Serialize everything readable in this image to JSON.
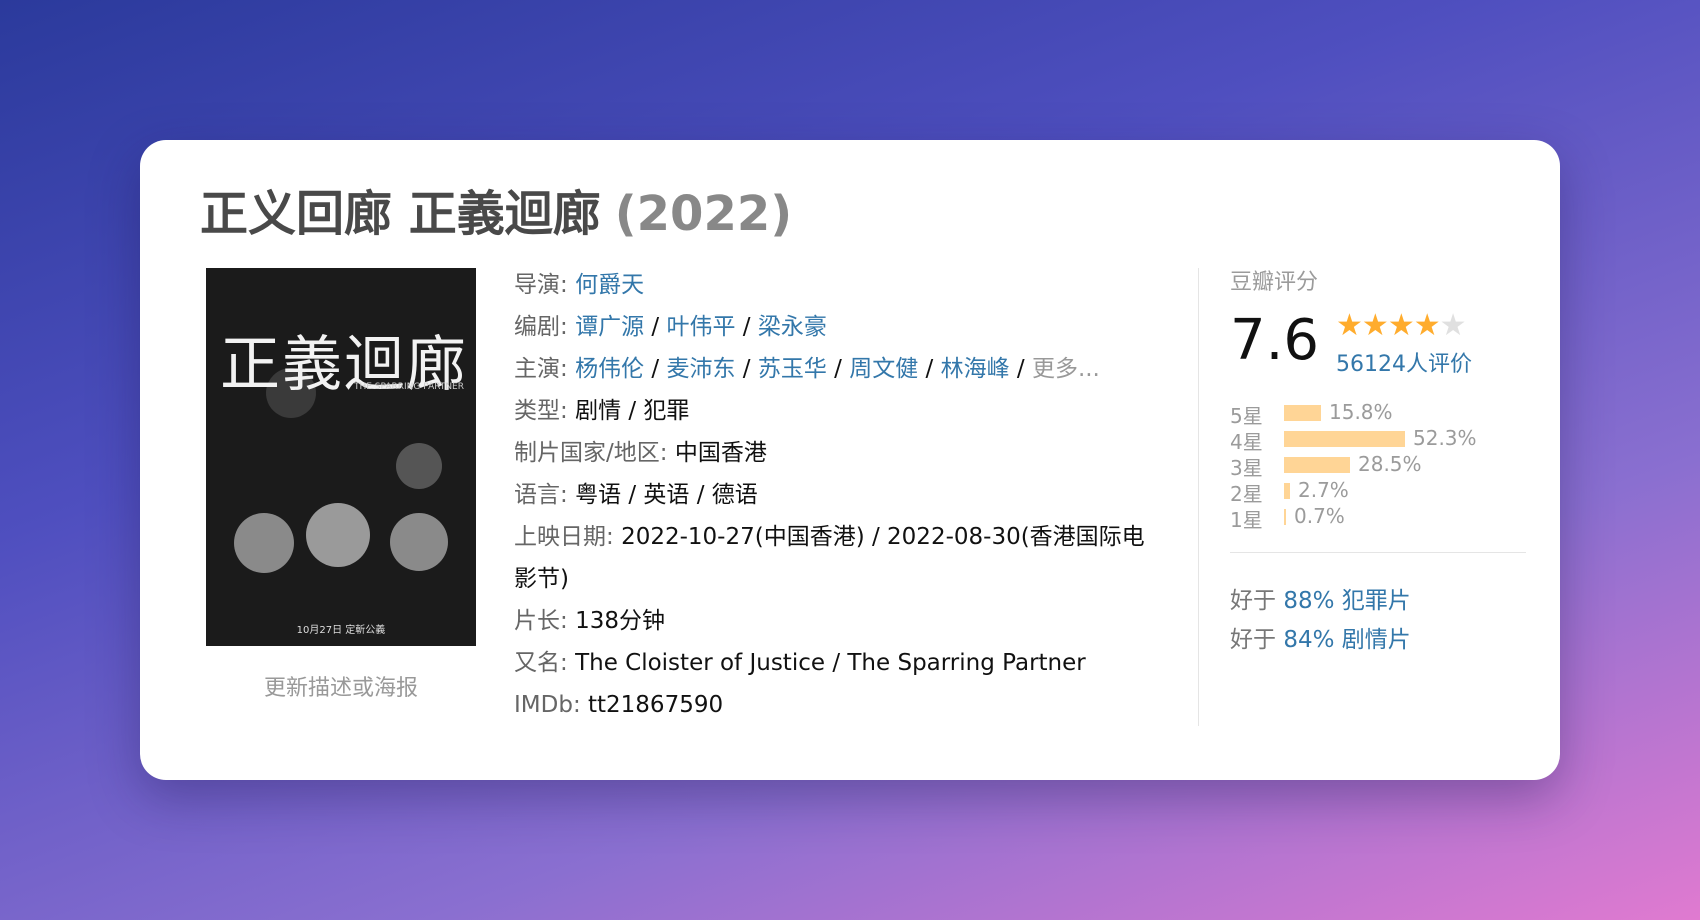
{
  "movie": {
    "title": "正义回廊 正義迴廊",
    "year": "(2022)"
  },
  "poster": {
    "title_art": "正義迴廊",
    "subtitle": "THE SPARRING PARTNER",
    "release_note": "10月27日 定斬公義",
    "update_link": "更新描述或海报"
  },
  "info": {
    "director_label": "导演:",
    "director": "何爵天",
    "writer_label": "编剧:",
    "writers": [
      "谭广源",
      "叶伟平",
      "梁永豪"
    ],
    "cast_label": "主演:",
    "cast": [
      "杨伟伦",
      "麦沛东",
      "苏玉华",
      "周文健",
      "林海峰"
    ],
    "more": "更多...",
    "genre_label": "类型:",
    "genres": "剧情 / 犯罪",
    "country_label": "制片国家/地区:",
    "country": "中国香港",
    "language_label": "语言:",
    "languages": "粤语 / 英语 / 德语",
    "release_label": "上映日期:",
    "release": "2022-10-27(中国香港) / 2022-08-30(香港国际电影节)",
    "runtime_label": "片长:",
    "runtime": "138分钟",
    "aka_label": "又名:",
    "aka": "The Cloister of Justice / The Sparring Partner",
    "imdb_label": "IMDb:",
    "imdb": "tt21867590",
    "separator": "/"
  },
  "rating": {
    "header": "豆瓣评分",
    "score": "7.6",
    "stars_value": 4,
    "stars_total": 5,
    "votes": "56124人评价",
    "distribution": [
      {
        "label": "5星",
        "percent": "15.8%",
        "value": 15.8
      },
      {
        "label": "4星",
        "percent": "52.3%",
        "value": 52.3
      },
      {
        "label": "3星",
        "percent": "28.5%",
        "value": 28.5
      },
      {
        "label": "2星",
        "percent": "2.7%",
        "value": 2.7
      },
      {
        "label": "1星",
        "percent": "0.7%",
        "value": 0.7
      }
    ],
    "better_than": [
      {
        "prefix": "好于",
        "pct": "88% 犯罪片"
      },
      {
        "prefix": "好于",
        "pct": "84% 剧情片"
      }
    ]
  },
  "colors": {
    "link": "#3377aa",
    "star": "#ffac2d",
    "bar": "#ffd596"
  }
}
